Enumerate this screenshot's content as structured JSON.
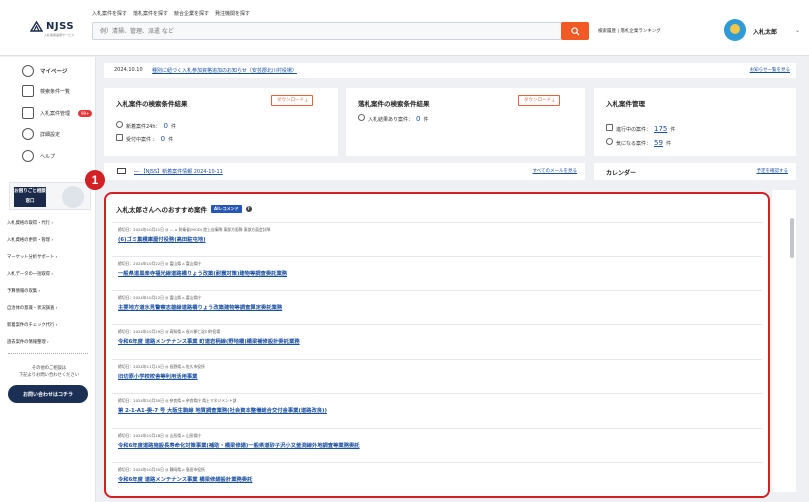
{
  "header": {
    "logo": "NJSS",
    "logo_sub": "入札情報速報サービス",
    "links": [
      "入札案件を探す",
      "落札案件を探す",
      "競合企業を探す",
      "発注機関を探す"
    ],
    "search_placeholder": "例）清掃、管理、派遣 など",
    "right_links": "検索履歴 | 落札企業ランキング",
    "user": "入札太郎"
  },
  "sidebar": {
    "items": [
      {
        "label": "マイページ"
      },
      {
        "label": "検索条件一覧"
      },
      {
        "label": "入札案件管理",
        "badge": "99+"
      },
      {
        "label": "詳細設定"
      },
      {
        "label": "ヘルプ"
      }
    ],
    "banner": "お困りごと相談窓口",
    "links": [
      "入札資格の取得・代行 ›",
      "入札資格の更新・管理 ›",
      "マーケット分析サポート ›",
      "入札データの一括取得 ›",
      "予算情報の収集 ›",
      "自治体の意識・状況調査 ›",
      "新着案件のチェック代行 ›",
      "過去案件の情報整理 ›"
    ],
    "note": "その他のご相談は\n下記よりお問い合わせください",
    "contact": "お問い合わせはコチラ"
  },
  "notice": {
    "date": "2024.10.10",
    "text": "種別に紐づく入札参加資格追加のお知らせ（安芸郡北川村役場）",
    "more": "お知らせ一覧を見る"
  },
  "search_results": {
    "title": "入札案件の検索条件結果",
    "download": "ダウンロード ⤓",
    "new_label": "新着案件24h：",
    "new_count": "0",
    "new_unit": "件",
    "open_label": "受付中案件 ：",
    "open_count": "0",
    "open_unit": "件"
  },
  "award_results": {
    "title": "落札案件の検索条件結果",
    "download": "ダウンロード ⤓",
    "label": "入札結果あり案件：",
    "count": "0",
    "unit": "件"
  },
  "management": {
    "title": "入札案件管理",
    "progress_label": "進行中の案件：",
    "progress_count": "175",
    "progress_unit": "件",
    "watch_label": "気になる案件：",
    "watch_count": "59",
    "watch_unit": "件"
  },
  "mail": {
    "text": "― 【NJSS】新着案件情報 2024-10-11",
    "more": "すべてのメールを見る"
  },
  "calendar": {
    "title": "カレンダー",
    "more": "予定を確認する"
  },
  "recommend": {
    "title": "入札太郎さんへのおすすめ案件",
    "ai_tag": "AIレコメンド",
    "marker": "1",
    "rows": [
      {
        "meta": "締切日：2024年10月21日  ◎ ---  ⌂ 防衛省(MOD) 陸上自衛隊 東部方面隊 東部方面会計隊",
        "title": "(6)ゴミ集積庫屋付役務(高田駐屯地)"
      },
      {
        "meta": "締切日：2024年10月22日  ◎ 富山県  ⌂ 富山県庁",
        "title": "一般県道黒楽寺福光線道路橋りょう改築(耐震対策)建物等調査委託業務"
      },
      {
        "meta": "締切日：2024年10月22日  ◎ 富山県  ⌂ 富山県庁",
        "title": "主要地方道氷見警察志雄線道路橋りょう改築建物等調査算定委託業務"
      },
      {
        "meta": "締切日：2024年10月29日  ◎ 高知県  ⌂ 長川郡仁淀川町役場",
        "title": "令和6年度 道路メンテナンス事業 町道岩柄線(野地橋)橋梁補修設計委託業務"
      },
      {
        "meta": "締切日：2024年11月15日  ◎ 長野県  ⌂ 佐久市役所",
        "title": "旧切原小学校校舎等利用活用事業"
      },
      {
        "meta": "締切日：2024年10月30日  ◎ 奈良県  ⌂ 奈良県庁 県土マネジメント部",
        "title": "第 2-1-A1-委-7 号 大阪生駒線 地質調査業務(社会資本整備総合交付金事業(道路改良))"
      },
      {
        "meta": "締切日：2024年10月18日  ◎ 山形県  ⌂ 山形県庁",
        "title": "令和6年度道路施設長寿命化対策事業(補助・橋梁修繕)一般県道砂子沢小又釜渕線外地調査等業務委託"
      },
      {
        "meta": "締切日：2024年10月30日  ◎ 静岡県  ⌂ 島田市役所",
        "title": "令和6年度 道路メンテナンス事業 橋梁修繕設計業務委託"
      }
    ]
  }
}
